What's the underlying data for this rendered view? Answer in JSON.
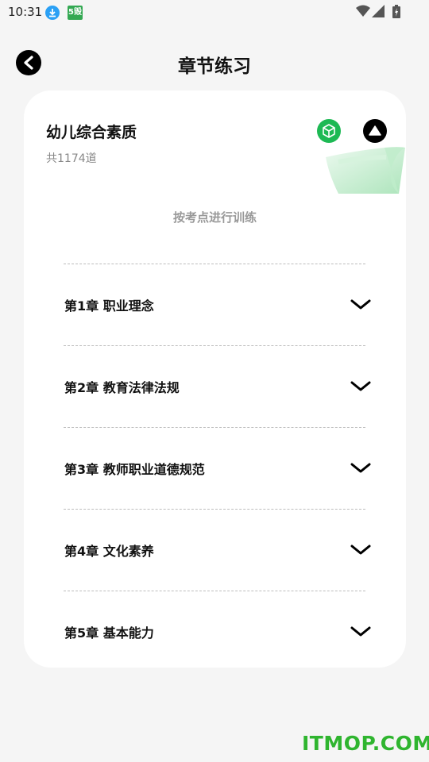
{
  "status_bar": {
    "time": "10:31",
    "app_badge": "5毁"
  },
  "header": {
    "title": "章节练习"
  },
  "subject": {
    "name": "幼儿综合素质",
    "count": "共1174道"
  },
  "subtitle": "按考点进行训练",
  "chapters": [
    {
      "label": "第1章 职业理念"
    },
    {
      "label": "第2章 教育法律法规"
    },
    {
      "label": "第3章 教师职业道德规范"
    },
    {
      "label": "第4章 文化素养"
    },
    {
      "label": "第5章 基本能力"
    }
  ],
  "watermark": "ITMOP.COM",
  "colors": {
    "accent_green": "#1db954",
    "watermark_green": "#2fb52f",
    "card_bg": "#ffffff",
    "page_bg": "#f5f5f5"
  }
}
